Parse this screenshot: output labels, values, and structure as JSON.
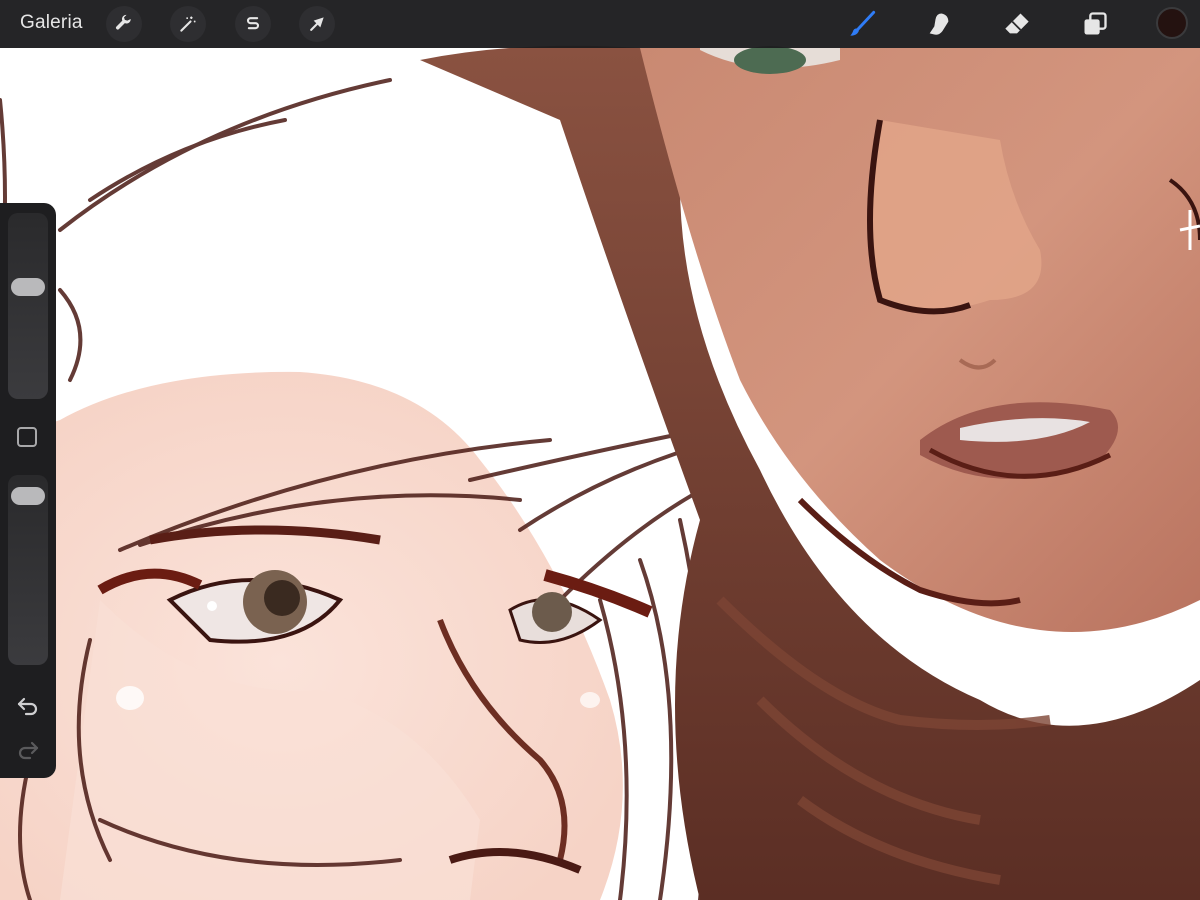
{
  "toolbar": {
    "gallery_label": "Galeria",
    "left_tools": [
      {
        "name": "actions",
        "icon": "wrench-icon"
      },
      {
        "name": "adjustments",
        "icon": "magic-wand-icon"
      },
      {
        "name": "selection",
        "icon": "selection-s-icon"
      },
      {
        "name": "transform",
        "icon": "arrow-cursor-icon"
      }
    ],
    "right_tools": [
      {
        "name": "brush",
        "icon": "brush-icon",
        "active": true
      },
      {
        "name": "smudge",
        "icon": "smudge-finger-icon",
        "active": false
      },
      {
        "name": "eraser",
        "icon": "eraser-icon",
        "active": false
      },
      {
        "name": "layers",
        "icon": "layers-icon",
        "active": false
      }
    ],
    "current_color": "#241210",
    "active_color": "#2f7cf6"
  },
  "sidebar": {
    "brush_size": 0.62,
    "brush_opacity": 0.95,
    "modify_icon": "square-icon",
    "undo_icon": "undo-arrow-icon",
    "redo_icon": "redo-arrow-icon"
  }
}
